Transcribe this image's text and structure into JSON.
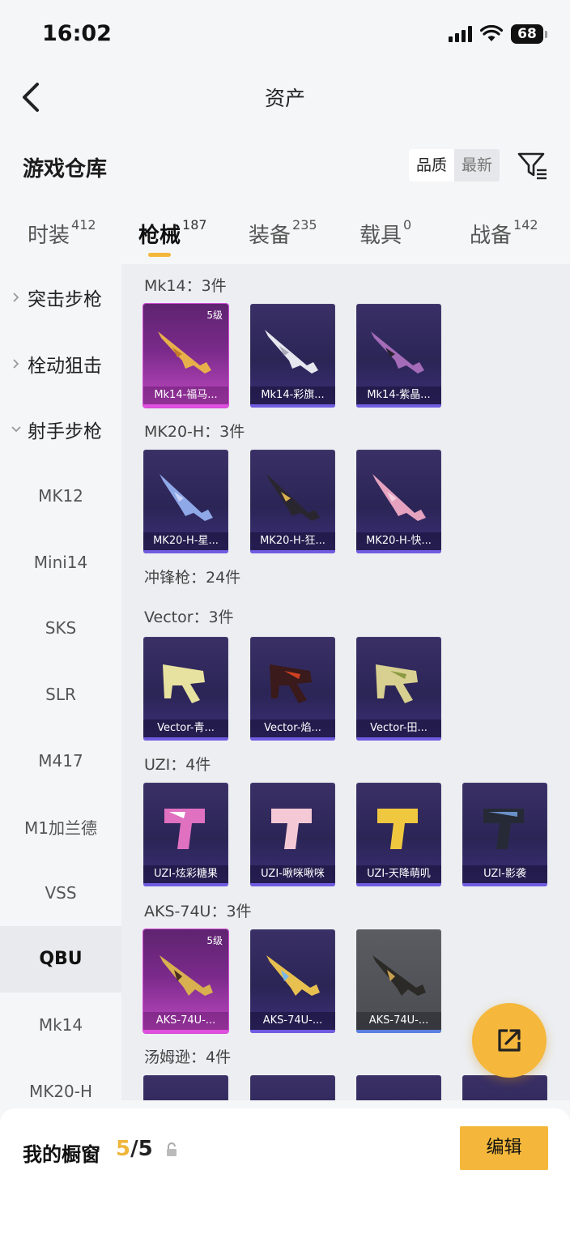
{
  "status_bar": {
    "time": "16:02",
    "battery": "68"
  },
  "nav": {
    "title": "资产"
  },
  "header": {
    "title": "游戏仓库",
    "sort_quality": "品质",
    "sort_latest": "最新"
  },
  "tabs": [
    {
      "label": "时装",
      "count": "412"
    },
    {
      "label": "枪械",
      "count": "187"
    },
    {
      "label": "装备",
      "count": "235"
    },
    {
      "label": "载具",
      "count": "0"
    },
    {
      "label": "战备",
      "count": "142"
    }
  ],
  "sidebar": {
    "groups": [
      "突击步枪",
      "栓动狙击",
      "射手步枪"
    ],
    "items": [
      "MK12",
      "Mini14",
      "SKS",
      "SLR",
      "M417",
      "M1加兰德",
      "VSS",
      "QBU",
      "Mk14",
      "MK20-H"
    ]
  },
  "content": {
    "categories": [
      "Mk14：3件",
      "MK20-H：3件",
      "冲锋枪：24件",
      "Vector：3件",
      "UZI：4件",
      "AKS-74U：3件",
      "汤姆逊：4件"
    ],
    "level_label": "5级",
    "items": {
      "mk14": [
        "Mk14-福马...",
        "Mk14-彩旗...",
        "Mk14-紫晶..."
      ],
      "mk20": [
        "MK20-H-星...",
        "MK20-H-狂...",
        "MK20-H-快..."
      ],
      "vector": [
        "Vector-青...",
        "Vector-焰...",
        "Vector-田..."
      ],
      "uzi": [
        "UZI-炫彩糖果",
        "UZI-啾咪啾咪",
        "UZI-天降萌叽",
        "UZI-影袭"
      ],
      "aks": [
        "AKS-74U-...",
        "AKS-74U-...",
        "AKS-74U-..."
      ]
    }
  },
  "showcase": {
    "label": "我的橱窗",
    "current": "5",
    "total": "/5",
    "edit": "编辑"
  },
  "colors": {
    "accent": "#f4b73b",
    "card_purple": "#2b2556",
    "card_pink": "#c14ac2"
  }
}
